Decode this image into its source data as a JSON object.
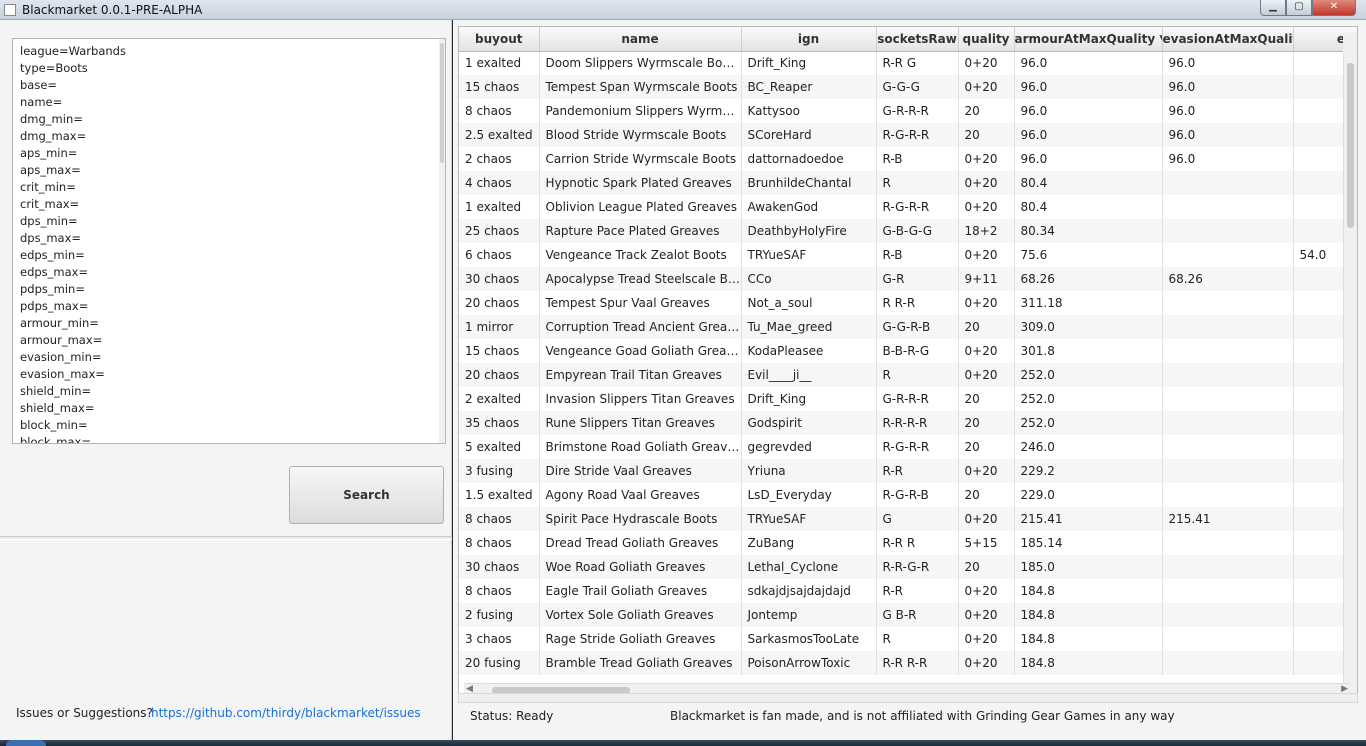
{
  "window": {
    "title": "Blackmarket 0.0.1-PRE-ALPHA"
  },
  "query": {
    "lines": [
      "league=Warbands",
      "type=Boots",
      "base=",
      "name=",
      "dmg_min=",
      "dmg_max=",
      "aps_min=",
      "aps_max=",
      "crit_min=",
      "crit_max=",
      "dps_min=",
      "dps_max=",
      "edps_min=",
      "edps_max=",
      "pdps_min=",
      "pdps_max=",
      "armour_min=",
      "armour_max=",
      "evasion_min=",
      "evasion_max=",
      "shield_min=",
      "shield_max=",
      "block_min=",
      "block_max="
    ]
  },
  "search": {
    "label": "Search"
  },
  "footer": {
    "issues_label": "Issues or Suggestions?",
    "issues_link": "https://github.com/thirdy/blackmarket/issues"
  },
  "table": {
    "columns": [
      "buyout",
      "name",
      "ign",
      "socketsRaw",
      "quality",
      "armourAtMaxQuality ▼",
      "evasionAtMaxQuality",
      "energySh"
    ],
    "rows": [
      [
        "1 exalted",
        "Doom Slippers Wyrmscale Boots",
        "Drift_King",
        "R-R G",
        "0+20",
        "96.0",
        "96.0",
        ""
      ],
      [
        "15 chaos",
        "Tempest Span Wyrmscale Boots",
        "BC_Reaper",
        "G-G-G",
        "0+20",
        "96.0",
        "96.0",
        ""
      ],
      [
        "8 chaos",
        "Pandemonium Slippers Wyrmscale...",
        "Kattysoo",
        "G-R-R-R",
        "20",
        "96.0",
        "96.0",
        ""
      ],
      [
        "2.5 exalted",
        "Blood Stride Wyrmscale Boots",
        "SCoreHard",
        "R-G-R-R",
        "20",
        "96.0",
        "96.0",
        ""
      ],
      [
        "2 chaos",
        "Carrion Stride Wyrmscale Boots",
        "dattornadoedoe",
        "R-B",
        "0+20",
        "96.0",
        "96.0",
        ""
      ],
      [
        "4 chaos",
        "Hypnotic Spark Plated Greaves",
        "BrunhildeChantal",
        "R",
        "0+20",
        "80.4",
        "",
        ""
      ],
      [
        "1 exalted",
        "Oblivion League Plated Greaves",
        "AwakenGod",
        "R-G-R-R",
        "0+20",
        "80.4",
        "",
        ""
      ],
      [
        "25 chaos",
        "Rapture Pace Plated Greaves",
        "DeathbyHolyFire",
        "G-B-G-G",
        "18+2",
        "80.34",
        "",
        ""
      ],
      [
        "6 chaos",
        "Vengeance Track Zealot Boots",
        "TRYueSAF",
        "R-B",
        "0+20",
        "75.6",
        "",
        "54.0"
      ],
      [
        "30 chaos",
        "Apocalypse Tread Steelscale Boots",
        "CCo",
        "G-R",
        "9+11",
        "68.26",
        "68.26",
        ""
      ],
      [
        "20 chaos",
        "Tempest Spur Vaal Greaves",
        "Not_a_soul",
        "R R-R",
        "0+20",
        "311.18",
        "",
        ""
      ],
      [
        "1 mirror",
        "Corruption Tread Ancient Greaves",
        "Tu_Mae_greed",
        "G-G-R-B",
        "20",
        "309.0",
        "",
        ""
      ],
      [
        "15 chaos",
        "Vengeance Goad Goliath Greaves",
        "KodaPleasee",
        "B-B-R-G",
        "0+20",
        "301.8",
        "",
        ""
      ],
      [
        "20 chaos",
        "Empyrean Trail Titan Greaves",
        "Evil____ji__",
        "R",
        "0+20",
        "252.0",
        "",
        ""
      ],
      [
        "2 exalted",
        "Invasion Slippers Titan Greaves",
        "Drift_King",
        "G-R-R-R",
        "20",
        "252.0",
        "",
        ""
      ],
      [
        "35 chaos",
        "Rune Slippers Titan Greaves",
        "Godspirit",
        "R-R-R-R",
        "20",
        "252.0",
        "",
        ""
      ],
      [
        "5 exalted",
        "Brimstone Road Goliath Greaves",
        "gegrevded",
        "R-G-R-R",
        "20",
        "246.0",
        "",
        ""
      ],
      [
        "3 fusing",
        "Dire Stride Vaal Greaves",
        "Yriuna",
        "R-R",
        "0+20",
        "229.2",
        "",
        ""
      ],
      [
        "1.5 exalted",
        "Agony Road Vaal Greaves",
        "LsD_Everyday",
        "R-G-R-B",
        "20",
        "229.0",
        "",
        ""
      ],
      [
        "8 chaos",
        "Spirit Pace Hydrascale Boots",
        "TRYueSAF",
        "G",
        "0+20",
        "215.41",
        "215.41",
        ""
      ],
      [
        "8 chaos",
        "Dread Tread Goliath Greaves",
        "ZuBang",
        "R-R R",
        "5+15",
        "185.14",
        "",
        ""
      ],
      [
        "30 chaos",
        "Woe Road Goliath Greaves",
        "Lethal_Cyclone",
        "R-R-G-R",
        "20",
        "185.0",
        "",
        ""
      ],
      [
        "8 chaos",
        "Eagle Trail Goliath Greaves",
        "sdkajdjsajdajdajd",
        "R-R",
        "0+20",
        "184.8",
        "",
        ""
      ],
      [
        "2 fusing",
        "Vortex Sole Goliath Greaves",
        "Jontemp",
        "G B-R",
        "0+20",
        "184.8",
        "",
        ""
      ],
      [
        "3 chaos",
        "Rage Stride Goliath Greaves",
        "SarkasmosTooLate",
        "R",
        "0+20",
        "184.8",
        "",
        ""
      ],
      [
        "20 fusing",
        "Bramble Tread Goliath Greaves",
        "PoisonArrowToxic",
        "R-R R-R",
        "0+20",
        "184.8",
        "",
        ""
      ]
    ]
  },
  "status": {
    "text": "Status: Ready",
    "disclaimer": "Blackmarket is fan made, and is not affiliated with Grinding Gear Games in any way"
  }
}
